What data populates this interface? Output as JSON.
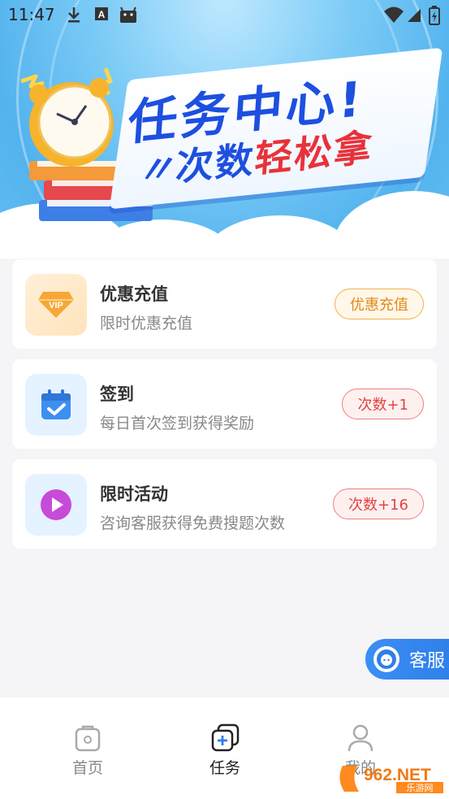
{
  "status_bar": {
    "time": "11:47",
    "icons": [
      "download-icon",
      "a-icon",
      "android-icon",
      "wifi-icon",
      "signal-icon",
      "battery-icon"
    ]
  },
  "banner": {
    "title": "任务中心!",
    "subtitle_prefix": "次数",
    "subtitle_highlight": "轻松拿",
    "colors": {
      "title": "#1d4fe0",
      "highlight": "#e8323b"
    }
  },
  "cards": [
    {
      "title": "优惠充值",
      "desc": "限时优惠充值",
      "button": "优惠充值",
      "icon": "vip-diamond-icon",
      "style": "gold"
    },
    {
      "title": "签到",
      "desc": "每日首次签到获得奖励",
      "button": "次数+1",
      "icon": "calendar-check-icon",
      "style": "red"
    },
    {
      "title": "限时活动",
      "desc": "咨询客服获得免费搜题次数",
      "button": "次数+16",
      "icon": "play-circle-icon",
      "style": "red"
    }
  ],
  "service": {
    "label": "客服"
  },
  "nav": {
    "items": [
      {
        "label": "首页",
        "icon": "home-bag-icon",
        "active": false
      },
      {
        "label": "任务",
        "icon": "task-plus-icon",
        "active": true
      },
      {
        "label": "我的",
        "icon": "user-icon",
        "active": false
      }
    ],
    "colors": {
      "active": "#222222",
      "inactive": "#888888"
    }
  },
  "watermark": {
    "text": "962.NET",
    "subtext": "乐游网"
  }
}
